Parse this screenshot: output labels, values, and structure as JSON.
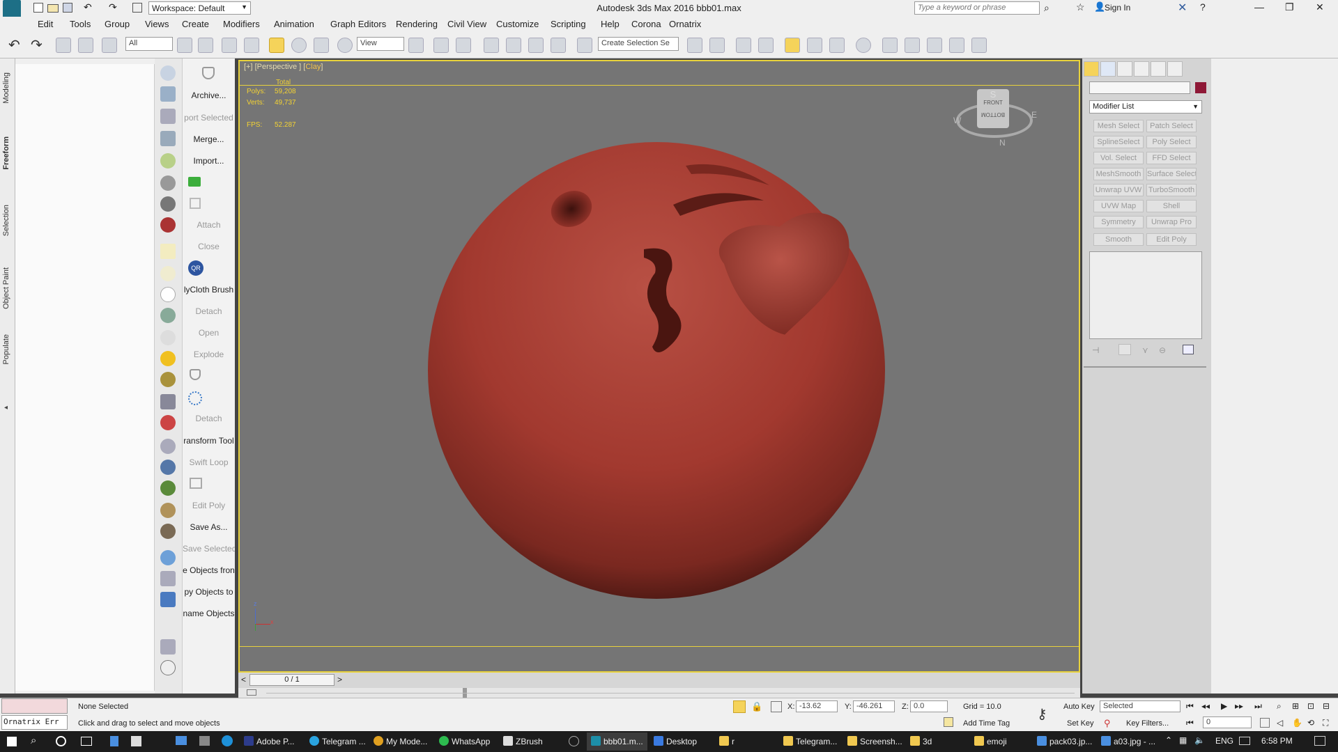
{
  "window": {
    "title": "Autodesk 3ds Max 2016    bbb01.max",
    "workspace": "Workspace: Default",
    "search_placeholder": "Type a keyword or phrase",
    "sign_in": "Sign In"
  },
  "menu": [
    "Edit",
    "Tools",
    "Group",
    "Views",
    "Create",
    "Modifiers",
    "Animation",
    "Graph Editors",
    "Rendering",
    "Civil View",
    "Customize",
    "Scripting",
    "Help",
    "Corona",
    "Ornatrix"
  ],
  "toolbar": {
    "filter": "All",
    "ref_coord": "View",
    "selection_set": "Create Selection Se"
  },
  "ribbon_tabs": [
    "Modeling",
    "Freeform",
    "Selection",
    "Object Paint",
    "Populate"
  ],
  "command_labels": [
    {
      "text": "Archive...",
      "dim": false
    },
    {
      "text": "port Selected",
      "dim": true
    },
    {
      "text": "Merge...",
      "dim": false
    },
    {
      "text": "Import...",
      "dim": false
    },
    {
      "text": "Attach",
      "dim": true
    },
    {
      "text": "Close",
      "dim": true
    },
    {
      "text": "lyCloth Brush",
      "dim": false
    },
    {
      "text": "Detach",
      "dim": true
    },
    {
      "text": "Open",
      "dim": true
    },
    {
      "text": "Explode",
      "dim": true
    },
    {
      "text": "Detach",
      "dim": true
    },
    {
      "text": "ransform Tool",
      "dim": false
    },
    {
      "text": "Swift Loop",
      "dim": true
    },
    {
      "text": "Edit Poly",
      "dim": true
    },
    {
      "text": "Save As...",
      "dim": false
    },
    {
      "text": "Save Selected",
      "dim": true
    },
    {
      "text": "e Objects fron",
      "dim": false
    },
    {
      "text": "py Objects to",
      "dim": false
    },
    {
      "text": "name Objects",
      "dim": false
    }
  ],
  "qr_badge": "QR",
  "viewport": {
    "label_prefix": "[+] [Perspective ] [",
    "shading": "Clay",
    "label_suffix": "]",
    "stats_header": "Total",
    "polys_label": "Polys:",
    "polys": "59,208",
    "verts_label": "Verts:",
    "verts": "49,737",
    "fps_label": "FPS:",
    "fps": "52.287",
    "viewcube": {
      "top": "S",
      "front": "FRONT",
      "bottom": "BOTTOM",
      "w": "W",
      "e": "E",
      "n": "N"
    },
    "axis_z": "z",
    "axis_x": "x",
    "frame": "0 / 1"
  },
  "modifier_panel": {
    "modifier_list": "Modifier List",
    "buttons": [
      "Mesh Select",
      "Patch Select",
      "SplineSelect",
      "Poly Select",
      "Vol. Select",
      "FFD Select",
      "MeshSmooth",
      "Surface Select",
      "Unwrap UVW",
      "TurboSmooth",
      "UVW Map",
      "Shell",
      "Symmetry",
      "Unwrap Pro",
      "Smooth",
      "Edit Poly"
    ],
    "swatch_color": "#8e1836"
  },
  "status": {
    "script_box": "Ornatrix Err",
    "selection": "None Selected",
    "prompt": "Click and drag to select and move objects",
    "x_label": "X:",
    "x": "-13.62",
    "y_label": "Y:",
    "y": "-46.261",
    "z_label": "Z:",
    "z": "0.0",
    "grid": "Grid = 10.0",
    "add_time_tag": "Add Time Tag",
    "auto_key": "Auto Key",
    "set_key": "Set Key",
    "key_mode": "Selected",
    "key_filters": "Key Filters...",
    "frame_field": "0"
  },
  "taskbar": {
    "items": [
      "Adobe P...",
      "Telegram ...",
      "My Mode...",
      "WhatsApp",
      "ZBrush",
      "bbb01.m...",
      "Desktop",
      "r",
      "Telegram...",
      "Screensh...",
      "3d",
      "emoji",
      "pack03.jp...",
      "a03.jpg - ..."
    ],
    "lang": "ENG",
    "time": "6:58 PM"
  }
}
